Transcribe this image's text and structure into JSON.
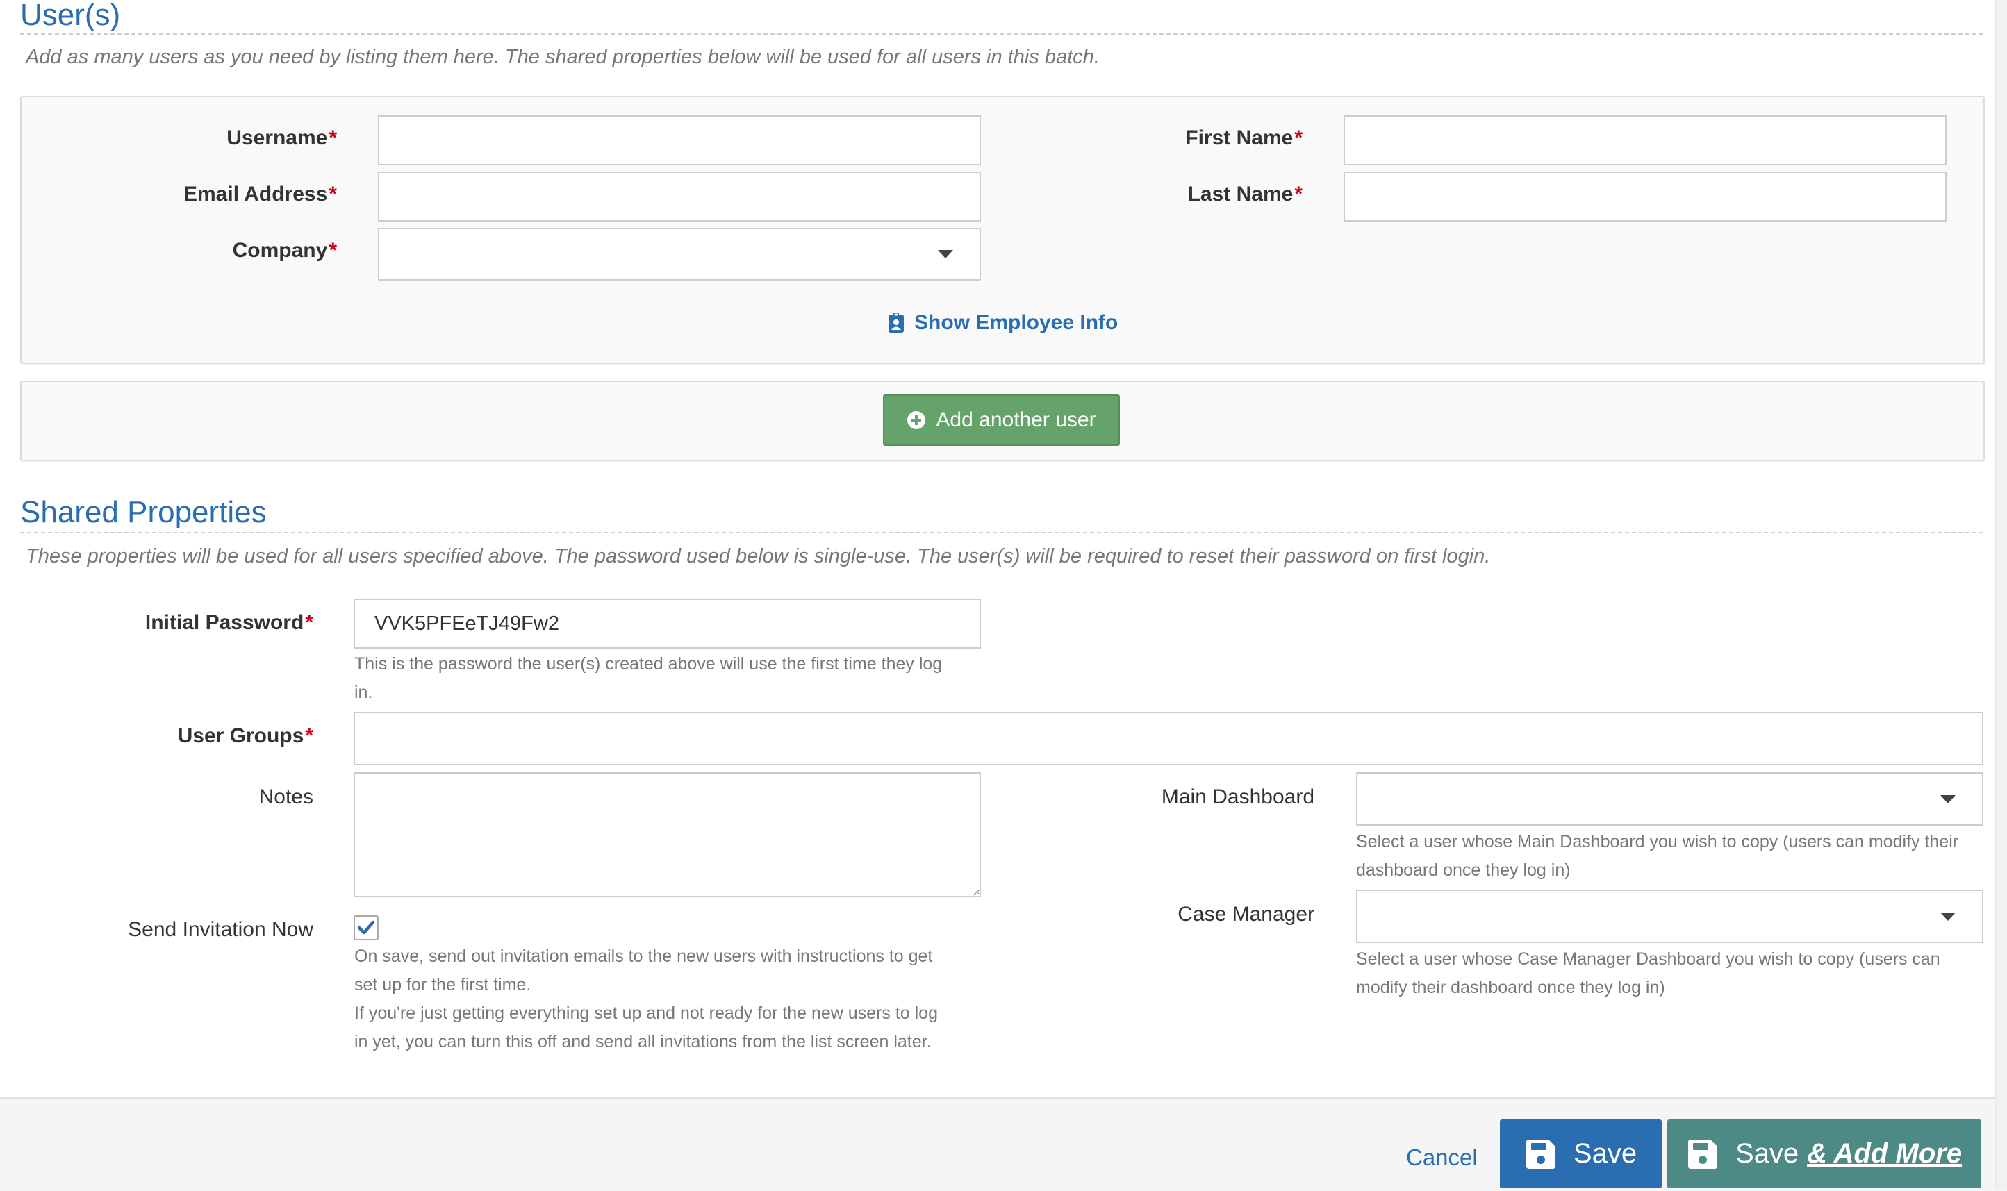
{
  "users_section": {
    "title": "User(s)",
    "description": "Add as many users as you need by listing them here. The shared properties below will be used for all users in this batch.",
    "fields": {
      "username": {
        "label": "Username",
        "required_mark": "*",
        "value": ""
      },
      "email": {
        "label": "Email Address",
        "required_mark": "*",
        "value": ""
      },
      "company": {
        "label": "Company",
        "required_mark": "*",
        "selected": ""
      },
      "first_name": {
        "label": "First Name",
        "required_mark": "*",
        "value": ""
      },
      "last_name": {
        "label": "Last Name",
        "required_mark": "*",
        "value": ""
      }
    },
    "show_employee_info": "Show Employee Info",
    "add_another_user": "Add another user"
  },
  "shared_section": {
    "title": "Shared Properties",
    "description": "These properties will be used for all users specified above. The password used below is single-use. The user(s) will be required to reset their password on first login.",
    "initial_password": {
      "label": "Initial Password",
      "required_mark": "*",
      "value": "VVK5PFEeTJ49Fw2",
      "help_line1": "This is the password the user(s) created above will use the first time they log",
      "help_line2": "in."
    },
    "user_groups": {
      "label": "User Groups",
      "required_mark": "*",
      "value": ""
    },
    "notes": {
      "label": "Notes",
      "value": ""
    },
    "send_invitation": {
      "label": "Send Invitation Now",
      "checked": true,
      "help_line1": "On save, send out invitation emails to the new users with instructions to get",
      "help_line2": "set up for the first time.",
      "help_line3": "If you're just getting everything set up and not ready for the new users to log",
      "help_line4": "in yet, you can turn this off and send all invitations from the list screen later."
    },
    "main_dashboard": {
      "label": "Main Dashboard",
      "selected": "",
      "help_line1": "Select a user whose Main Dashboard you wish to copy (users can modify their",
      "help_line2": "dashboard once they log in)"
    },
    "case_manager": {
      "label": "Case Manager",
      "selected": "",
      "help_line1": "Select a user whose Case Manager Dashboard you wish to copy (users can",
      "help_line2": "modify their dashboard once they log in)"
    }
  },
  "footer": {
    "cancel": "Cancel",
    "save": "Save",
    "save_add_more_prefix": "Save",
    "save_add_more_link": "& Add More"
  },
  "colors": {
    "accent_blue": "#2a6db1",
    "success_green": "#66a36b",
    "save_add_more_teal": "#4e8a85",
    "required_red": "#d0021b"
  }
}
